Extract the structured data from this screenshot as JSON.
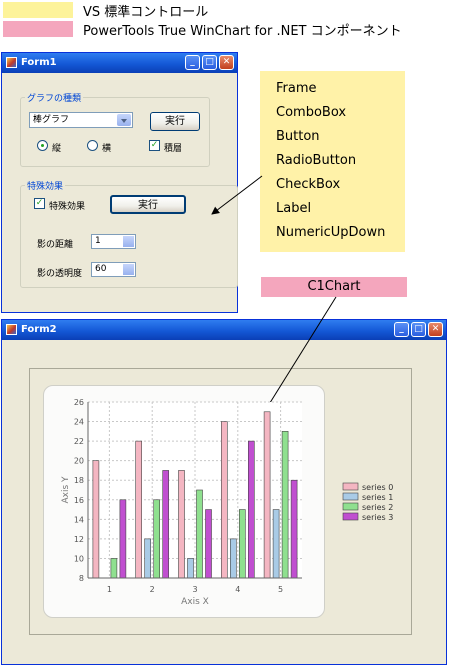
{
  "legend": {
    "vs_label": "VS 標準コントロール",
    "pt_label": "PowerTools True WinChart for .NET コンポーネント",
    "vs_color": "#fdf39a",
    "pt_color": "#f4a6bd"
  },
  "form1": {
    "title": "Form1",
    "group1_label": "グラフの種類",
    "combo_value": "棒グラフ",
    "run_button": "実行",
    "radio_vertical": "縦",
    "radio_horizontal": "横",
    "check_stacked": "積層",
    "group2_label": "特殊効果",
    "check_effect": "特殊効果",
    "run_button2": "実行",
    "depth_label": "影の距離",
    "depth_value": "1",
    "opacity_label": "影の透明度",
    "opacity_value": "60"
  },
  "callout": {
    "items": [
      "Frame",
      "ComboBox",
      "Button",
      "RadioButton",
      "CheckBox",
      "Label",
      "NumericUpDown"
    ]
  },
  "c1chart_label": "C1Chart",
  "form2": {
    "title": "Form2"
  },
  "chart_data": {
    "type": "bar",
    "categories": [
      "1",
      "2",
      "3",
      "4",
      "5"
    ],
    "series": [
      {
        "name": "series 0",
        "values": [
          20,
          22,
          19,
          24,
          25
        ],
        "color": "#f4b6c2"
      },
      {
        "name": "series 1",
        "values": [
          8,
          12,
          10,
          12,
          15
        ],
        "color": "#a9cbe6"
      },
      {
        "name": "series 2",
        "values": [
          10,
          16,
          17,
          15,
          23
        ],
        "color": "#8fe08f"
      },
      {
        "name": "series 3",
        "values": [
          16,
          19,
          15,
          22,
          18
        ],
        "color": "#c04fd0"
      }
    ],
    "xlabel": "Axis X",
    "ylabel": "Axis Y",
    "ylim": [
      8,
      26
    ],
    "yticks": [
      "8",
      "10",
      "12",
      "14",
      "16",
      "18",
      "20",
      "22",
      "24",
      "26"
    ],
    "grid": true,
    "legend_position": "right"
  }
}
